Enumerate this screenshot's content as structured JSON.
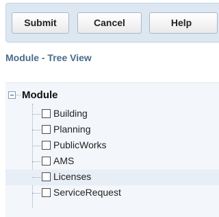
{
  "toolbar": {
    "submit_label": "Submit",
    "cancel_label": "Cancel",
    "help_label": "Help"
  },
  "section_title": "Module - Tree View",
  "tree": {
    "root_label": "Module",
    "expanded": true,
    "items": [
      {
        "label": "Building",
        "checked": false
      },
      {
        "label": "Planning",
        "checked": false
      },
      {
        "label": "PublicWorks",
        "checked": false
      },
      {
        "label": "AMS",
        "checked": false
      },
      {
        "label": "Licenses",
        "checked": false
      },
      {
        "label": "ServiceRequest",
        "checked": false
      }
    ]
  }
}
